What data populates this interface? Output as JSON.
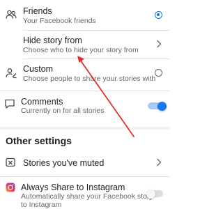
{
  "audience": {
    "friends": {
      "label": "Friends",
      "sublabel": "Your Facebook friends",
      "selected": true
    },
    "hide_story_from": {
      "label": "Hide story from",
      "sublabel": "Choose who to hide your story from"
    },
    "custom": {
      "label": "Custom",
      "sublabel": "Choose people to share your stories with",
      "selected": false
    }
  },
  "comments": {
    "label": "Comments",
    "sublabel": "Currently on for all stories",
    "enabled": true
  },
  "other_settings": {
    "title": "Other settings",
    "muted": {
      "label": "Stories you've muted"
    },
    "instagram": {
      "label": "Always Share to Instagram",
      "sublabel": "Automatically share your Facebook story to Instagram",
      "enabled": false
    }
  },
  "colors": {
    "accent": "#1877f2",
    "annotation_arrow": "#e0302a"
  }
}
